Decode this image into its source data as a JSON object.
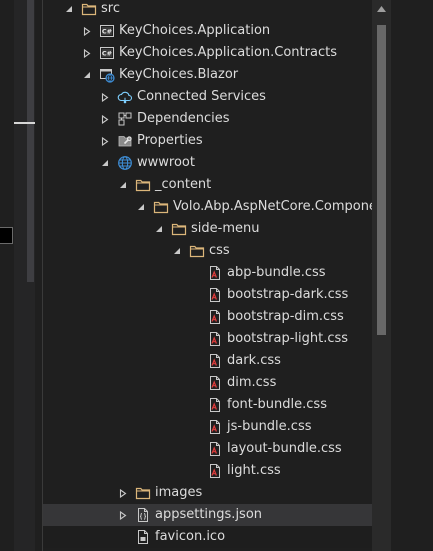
{
  "tree": {
    "items": [
      {
        "label": "src",
        "icon": "folder-icon",
        "expander": "expanded"
      },
      {
        "label": "KeyChoices.Application",
        "icon": "csharp-project-icon",
        "expander": "collapsed"
      },
      {
        "label": "KeyChoices.Application.Contracts",
        "icon": "csharp-project-icon",
        "expander": "collapsed"
      },
      {
        "label": "KeyChoices.Blazor",
        "icon": "blazor-project-icon",
        "expander": "expanded"
      },
      {
        "label": "Connected Services",
        "icon": "connected-services-icon",
        "expander": "collapsed"
      },
      {
        "label": "Dependencies",
        "icon": "dependencies-icon",
        "expander": "collapsed"
      },
      {
        "label": "Properties",
        "icon": "properties-icon",
        "expander": "collapsed"
      },
      {
        "label": "wwwroot",
        "icon": "globe-icon",
        "expander": "expanded"
      },
      {
        "label": "_content",
        "icon": "folder-icon",
        "expander": "expanded"
      },
      {
        "label": "Volo.Abp.AspNetCore.Components",
        "icon": "folder-icon",
        "expander": "expanded"
      },
      {
        "label": "side-menu",
        "icon": "folder-icon",
        "expander": "expanded"
      },
      {
        "label": "css",
        "icon": "folder-icon",
        "expander": "expanded"
      },
      {
        "label": "abp-bundle.css",
        "icon": "css-file-icon",
        "expander": "none"
      },
      {
        "label": "bootstrap-dark.css",
        "icon": "css-file-icon",
        "expander": "none"
      },
      {
        "label": "bootstrap-dim.css",
        "icon": "css-file-icon",
        "expander": "none"
      },
      {
        "label": "bootstrap-light.css",
        "icon": "css-file-icon",
        "expander": "none"
      },
      {
        "label": "dark.css",
        "icon": "css-file-icon",
        "expander": "none"
      },
      {
        "label": "dim.css",
        "icon": "css-file-icon",
        "expander": "none"
      },
      {
        "label": "font-bundle.css",
        "icon": "css-file-icon",
        "expander": "none"
      },
      {
        "label": "js-bundle.css",
        "icon": "css-file-icon",
        "expander": "none"
      },
      {
        "label": "layout-bundle.css",
        "icon": "css-file-icon",
        "expander": "none"
      },
      {
        "label": "light.css",
        "icon": "css-file-icon",
        "expander": "none"
      },
      {
        "label": "images",
        "icon": "folder-icon",
        "expander": "collapsed"
      },
      {
        "label": "appsettings.json",
        "icon": "json-file-icon",
        "expander": "collapsed",
        "selected": true
      },
      {
        "label": "favicon.ico",
        "icon": "favicon-file-icon",
        "expander": "none"
      }
    ]
  },
  "colors": {
    "background": "#1f1f1f",
    "text": "#dcdcdc",
    "selected_row": "#363638",
    "folder": "#dcb67a",
    "csharp": "#68217a",
    "css_red": "#e03c3c",
    "globe": "#3e8fd9"
  },
  "scrollbar": {
    "arrow_icon": "scroll-up-arrow-icon"
  }
}
